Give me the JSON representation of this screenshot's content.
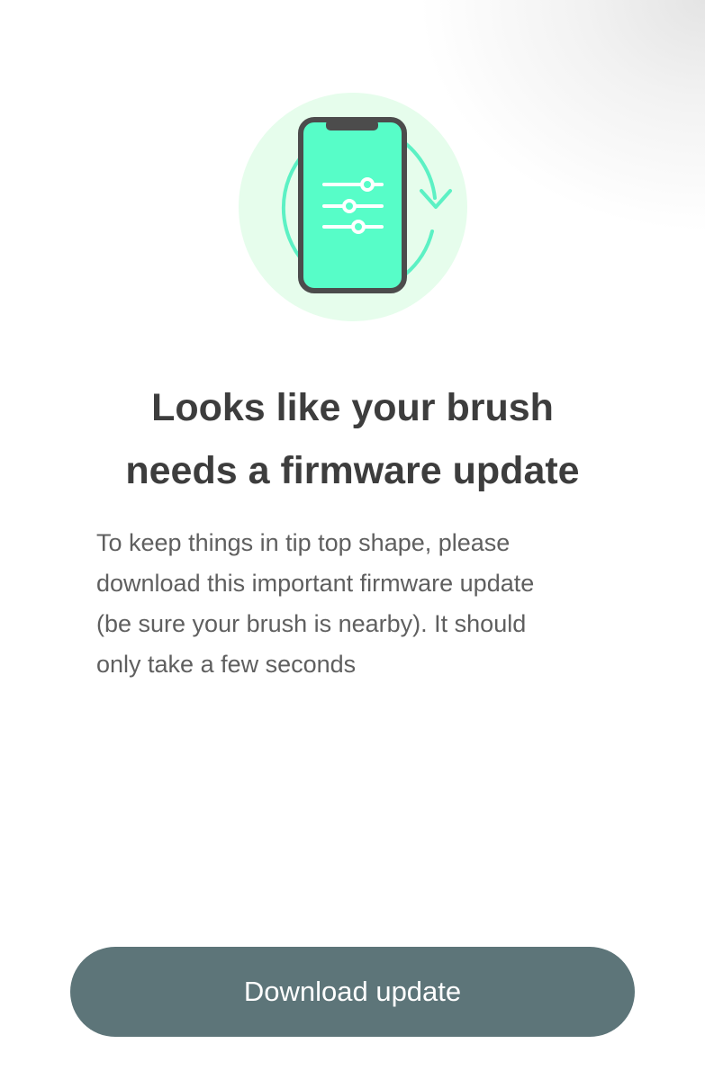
{
  "illustration": {
    "icon": "phone-firmware-update-icon",
    "colors": {
      "background_circle": "#e6fdec",
      "sync_arrow": "#5cf1c4",
      "phone_screen": "#57fdc8",
      "phone_frame": "#4c4c4c",
      "slider_lines": "#ffffff"
    }
  },
  "content": {
    "headline_lines": [
      "Looks like your brush",
      "needs a firmware update"
    ],
    "body_lines": [
      "To keep things in tip top shape, please",
      "download this important firmware update",
      "(be sure your brush is nearby). It should",
      "only take a few seconds"
    ]
  },
  "actions": {
    "download_label": "Download update"
  },
  "colors": {
    "headline": "#3d3d3d",
    "body": "#5f5f5f",
    "button_background": "#5d7579",
    "button_text": "#ffffff"
  }
}
